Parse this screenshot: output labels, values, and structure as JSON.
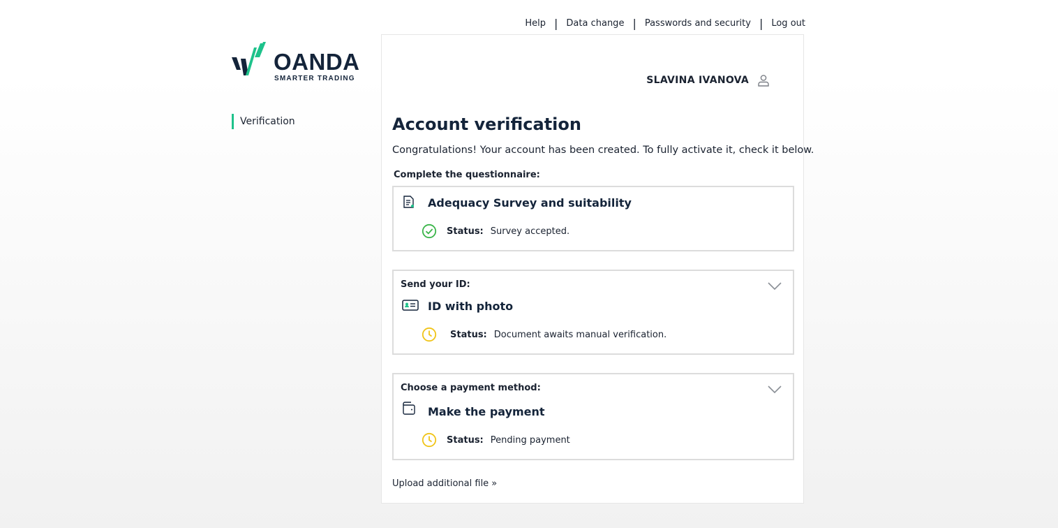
{
  "topnav": {
    "help": "Help",
    "data_change": "Data change",
    "passwords": "Passwords and security",
    "logout": "Log out",
    "separator": "|"
  },
  "logo": {
    "brand": "OANDA",
    "tagline": "SMARTER TRADING",
    "accent": "#1ec28b",
    "dark": "#14243a"
  },
  "sidebar": {
    "items": [
      {
        "label": "Verification",
        "active": true
      }
    ]
  },
  "user": {
    "name": "SLAVINA IVANOVA",
    "icon": "user-icon"
  },
  "page": {
    "title": "Account verification",
    "intro": "Congratulations! Your account has been created. To fully activate it, check it below.",
    "questionnaire_label": "Complete the questionnaire:"
  },
  "cards": {
    "survey": {
      "title": "Adequacy Survey and suitability",
      "icon": "document-icon",
      "status_label": "Status:",
      "status_value": "Survey accepted.",
      "status_icon": "check-circle-icon",
      "status_color": "#3bb54a"
    },
    "id": {
      "sub": "Send your ID:",
      "title": "ID with photo",
      "icon": "id-card-icon",
      "status_label": "Status:",
      "status_value": "Document awaits manual verification.",
      "status_icon": "clock-icon",
      "status_color": "#f0c419"
    },
    "payment": {
      "sub": "Choose a payment method:",
      "title": "Make the payment",
      "icon": "wallet-icon",
      "status_label": "Status:",
      "status_value": "Pending payment",
      "status_icon": "clock-icon",
      "status_color": "#f0c419"
    }
  },
  "upload_link": "Upload additional file »"
}
